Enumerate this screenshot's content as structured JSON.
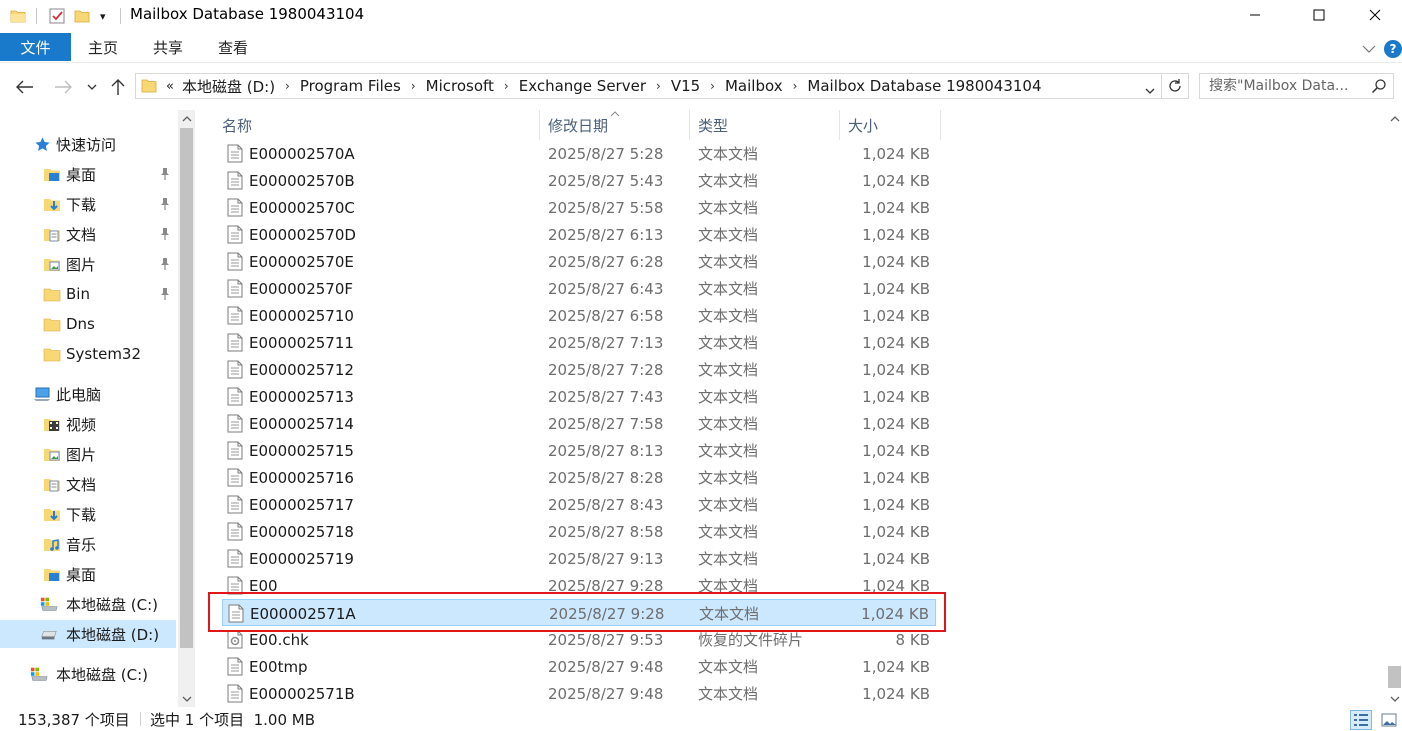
{
  "window": {
    "title": "Mailbox Database 1980043104",
    "controls": {
      "minimize": "—",
      "maximize": "☐",
      "close": "✕"
    }
  },
  "quick_access_toolbar": {
    "dropdown": "▾"
  },
  "ribbon": {
    "tabs": [
      {
        "label": "文件",
        "active": true
      },
      {
        "label": "主页"
      },
      {
        "label": "共享"
      },
      {
        "label": "查看"
      }
    ],
    "expand_chevron": "﹀",
    "help": "?"
  },
  "address_bar": {
    "overflow": "«",
    "crumbs": [
      "本地磁盘 (D:)",
      "Program Files",
      "Microsoft",
      "Exchange Server",
      "V15",
      "Mailbox",
      "Mailbox Database 1980043104"
    ],
    "separator": "›",
    "dropdown": "⌄"
  },
  "search": {
    "placeholder": "搜索\"Mailbox Data..."
  },
  "nav": {
    "quick_access": {
      "label": "快速访问"
    },
    "quick_items": [
      {
        "label": "桌面",
        "icon": "desktop-folder-icon",
        "pinned": true
      },
      {
        "label": "下载",
        "icon": "downloads-folder-icon",
        "pinned": true
      },
      {
        "label": "文档",
        "icon": "documents-folder-icon",
        "pinned": true
      },
      {
        "label": "图片",
        "icon": "pictures-folder-icon",
        "pinned": true
      },
      {
        "label": "Bin",
        "icon": "folder-icon",
        "pinned": true
      },
      {
        "label": "Dns",
        "icon": "folder-icon",
        "pinned": false
      },
      {
        "label": "System32",
        "icon": "folder-icon",
        "pinned": false
      }
    ],
    "this_pc": {
      "label": "此电脑"
    },
    "pc_items": [
      {
        "label": "视频",
        "icon": "videos-folder-icon"
      },
      {
        "label": "图片",
        "icon": "pictures-folder-icon"
      },
      {
        "label": "文档",
        "icon": "documents-folder-icon"
      },
      {
        "label": "下载",
        "icon": "downloads-folder-icon"
      },
      {
        "label": "音乐",
        "icon": "music-folder-icon"
      },
      {
        "label": "桌面",
        "icon": "desktop-folder-icon"
      },
      {
        "label": "本地磁盘 (C:)",
        "icon": "system-drive-icon"
      },
      {
        "label": "本地磁盘 (D:)",
        "icon": "drive-icon",
        "selected": true
      }
    ],
    "network_drive": {
      "label": "本地磁盘 (C:)"
    }
  },
  "columns": {
    "name": "名称",
    "date": "修改日期",
    "type": "类型",
    "size": "大小",
    "sort_indicator": "^"
  },
  "files": [
    {
      "name": "E000002570A",
      "date": "2025/8/27 5:28",
      "type": "文本文档",
      "size": "1,024 KB"
    },
    {
      "name": "E000002570B",
      "date": "2025/8/27 5:43",
      "type": "文本文档",
      "size": "1,024 KB"
    },
    {
      "name": "E000002570C",
      "date": "2025/8/27 5:58",
      "type": "文本文档",
      "size": "1,024 KB"
    },
    {
      "name": "E000002570D",
      "date": "2025/8/27 6:13",
      "type": "文本文档",
      "size": "1,024 KB"
    },
    {
      "name": "E000002570E",
      "date": "2025/8/27 6:28",
      "type": "文本文档",
      "size": "1,024 KB"
    },
    {
      "name": "E000002570F",
      "date": "2025/8/27 6:43",
      "type": "文本文档",
      "size": "1,024 KB"
    },
    {
      "name": "E0000025710",
      "date": "2025/8/27 6:58",
      "type": "文本文档",
      "size": "1,024 KB"
    },
    {
      "name": "E0000025711",
      "date": "2025/8/27 7:13",
      "type": "文本文档",
      "size": "1,024 KB"
    },
    {
      "name": "E0000025712",
      "date": "2025/8/27 7:28",
      "type": "文本文档",
      "size": "1,024 KB"
    },
    {
      "name": "E0000025713",
      "date": "2025/8/27 7:43",
      "type": "文本文档",
      "size": "1,024 KB"
    },
    {
      "name": "E0000025714",
      "date": "2025/8/27 7:58",
      "type": "文本文档",
      "size": "1,024 KB"
    },
    {
      "name": "E0000025715",
      "date": "2025/8/27 8:13",
      "type": "文本文档",
      "size": "1,024 KB"
    },
    {
      "name": "E0000025716",
      "date": "2025/8/27 8:28",
      "type": "文本文档",
      "size": "1,024 KB"
    },
    {
      "name": "E0000025717",
      "date": "2025/8/27 8:43",
      "type": "文本文档",
      "size": "1,024 KB"
    },
    {
      "name": "E0000025718",
      "date": "2025/8/27 8:58",
      "type": "文本文档",
      "size": "1,024 KB"
    },
    {
      "name": "E0000025719",
      "date": "2025/8/27 9:13",
      "type": "文本文档",
      "size": "1,024 KB"
    },
    {
      "name": "E00",
      "date": "2025/8/27 9:28",
      "type": "文本文档",
      "size": "1,024 KB"
    },
    {
      "name": "E000002571A",
      "date": "2025/8/27 9:28",
      "type": "文本文档",
      "size": "1,024 KB",
      "selected": true
    },
    {
      "name": "E00.chk",
      "date": "2025/8/27 9:53",
      "type": "恢复的文件碎片",
      "size": "8 KB",
      "icon": "recovered-fragment-icon"
    },
    {
      "name": "E00tmp",
      "date": "2025/8/27 9:48",
      "type": "文本文档",
      "size": "1,024 KB"
    },
    {
      "name": "E000002571B",
      "date": "2025/8/27 9:48",
      "type": "文本文档",
      "size": "1,024 KB"
    }
  ],
  "status_bar": {
    "item_count": "153,387 个项目",
    "selection": "选中 1 个项目  1.00 MB"
  },
  "colors": {
    "accent": "#1979ca",
    "selection_bg": "#cce8ff",
    "selection_border": "#99d1ff",
    "highlight_box": "#e0161b",
    "folder_yellow": "#f8d775"
  }
}
